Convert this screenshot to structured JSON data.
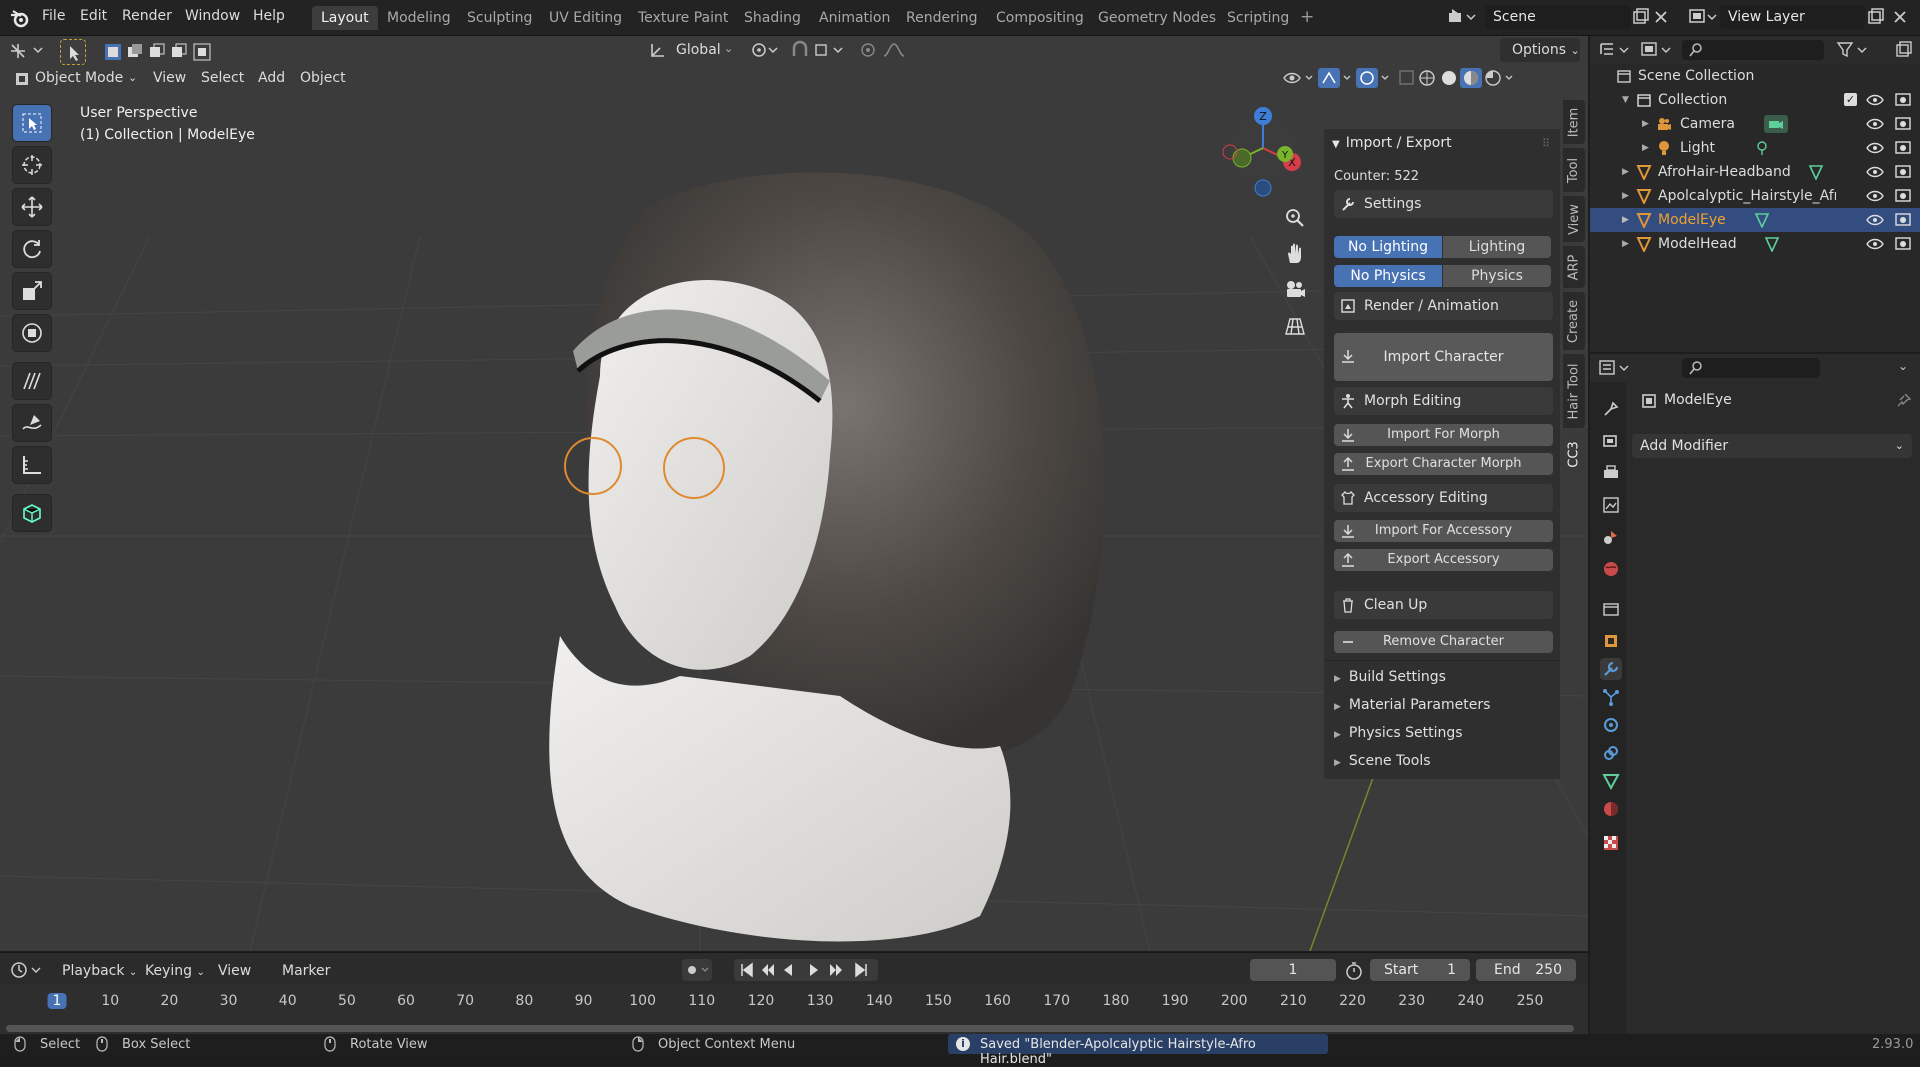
{
  "menu": {
    "items": [
      "File",
      "Edit",
      "Render",
      "Window",
      "Help"
    ]
  },
  "workspaces": [
    "Layout",
    "Modeling",
    "Sculpting",
    "UV Editing",
    "Texture Paint",
    "Shading",
    "Animation",
    "Rendering",
    "Compositing",
    "Geometry Nodes",
    "Scripting"
  ],
  "active_workspace": "Layout",
  "scene": {
    "name": "Scene",
    "view_layer": "View Layer"
  },
  "viewport": {
    "transform_orientation": "Global",
    "options_label": "Options",
    "mode": "Object Mode",
    "menus": [
      "View",
      "Select",
      "Add",
      "Object"
    ],
    "perspective": "User Perspective",
    "collection_info": "(1) Collection | ModelEye",
    "gizmo_axes": {
      "z": "Z",
      "y": "Y",
      "x": "X"
    }
  },
  "npanel": {
    "title": "Import / Export",
    "counter": "Counter: 522",
    "settings": "Settings",
    "no_lighting": "No Lighting",
    "lighting": "Lighting",
    "no_physics": "No Physics",
    "physics": "Physics",
    "render_animation": "Render / Animation",
    "import_character": "Import Character",
    "morph_editing": "Morph Editing",
    "import_for_morph": "Import For Morph",
    "export_character_morph": "Export Character Morph",
    "accessory_editing": "Accessory Editing",
    "import_for_accessory": "Import For Accessory",
    "export_accessory": "Export Accessory",
    "clean_up": "Clean Up",
    "remove_character": "Remove Character",
    "subpanels": [
      "Build Settings",
      "Material Parameters",
      "Physics Settings",
      "Scene Tools"
    ],
    "tabs": [
      "Item",
      "Tool",
      "View",
      "ARP",
      "Create",
      "Hair Tool",
      "CC3"
    ]
  },
  "outliner": {
    "root": "Scene Collection",
    "collection": "Collection",
    "items": [
      {
        "name": "Camera",
        "indent": 2
      },
      {
        "name": "Light",
        "indent": 2
      },
      {
        "name": "AfroHair-Headband",
        "indent": 1
      },
      {
        "name": "Apolcalyptic_Hairstyle_Afro_I",
        "indent": 1
      },
      {
        "name": "ModelEye",
        "indent": 1,
        "selected": true
      },
      {
        "name": "ModelHead",
        "indent": 1
      }
    ]
  },
  "properties": {
    "object_name": "ModelEye",
    "add_modifier": "Add Modifier"
  },
  "timeline": {
    "menus": [
      "Playback",
      "Keying",
      "View",
      "Marker"
    ],
    "current_frame": "1",
    "start_label": "Start",
    "start": "1",
    "end_label": "End",
    "end": "250",
    "ticks": [
      "1",
      "10",
      "20",
      "30",
      "40",
      "50",
      "60",
      "70",
      "80",
      "90",
      "100",
      "110",
      "120",
      "130",
      "140",
      "150",
      "160",
      "170",
      "180",
      "190",
      "200",
      "210",
      "220",
      "230",
      "240",
      "250"
    ]
  },
  "status": {
    "select": "Select",
    "box_select": "Box Select",
    "rotate_view": "Rotate View",
    "context_menu": "Object Context Menu",
    "message": "Saved \"Blender-Apolcalyptic Hairstyle-Afro Hair.blend\"",
    "version": "2.93.0"
  },
  "colors": {
    "accent": "#4772b3",
    "selected_text": "#f0a030",
    "bg": "#3b3b3b"
  }
}
